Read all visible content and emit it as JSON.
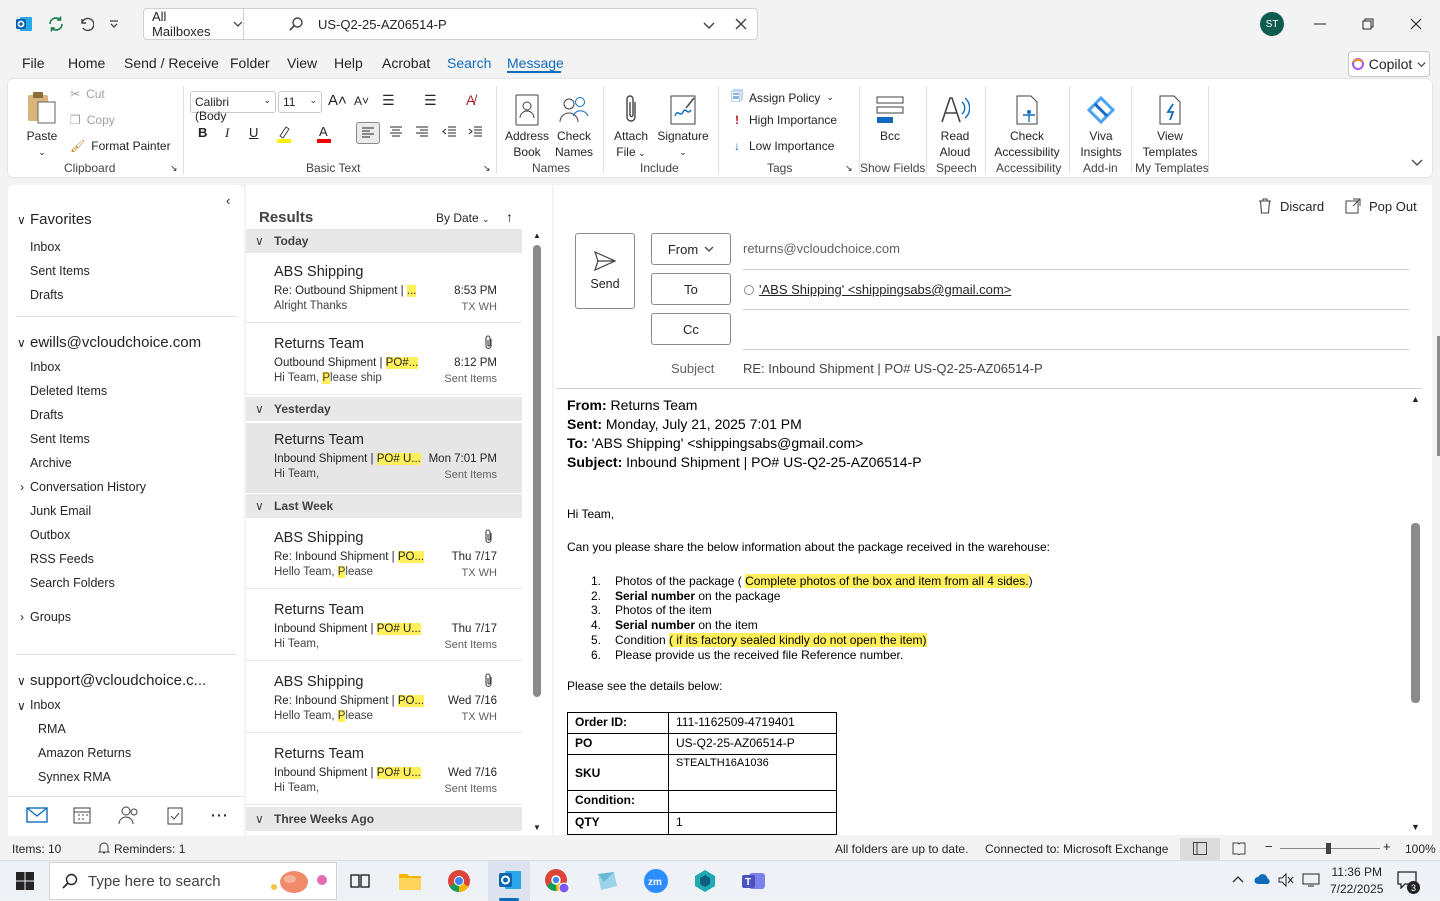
{
  "titlebar": {
    "mailbox_scope": "All Mailboxes",
    "search_value": "US-Q2-25-AZ06514-P",
    "avatar_initials": "ST"
  },
  "menu": {
    "items": [
      "File",
      "Home",
      "Send / Receive",
      "Folder",
      "View",
      "Help",
      "Acrobat",
      "Search",
      "Message"
    ],
    "active": "Message",
    "copilot": "Copilot"
  },
  "ribbon": {
    "paste": "Paste",
    "cut": "Cut",
    "copy": "Copy",
    "format_painter": "Format Painter",
    "font_name": "Calibri (Body",
    "font_size": "11",
    "address_book": [
      "Address",
      "Book"
    ],
    "check_names": [
      "Check",
      "Names"
    ],
    "attach_file": [
      "Attach",
      "File"
    ],
    "signature": "Signature",
    "assign_policy": "Assign Policy",
    "high_importance": "High Importance",
    "low_importance": "Low Importance",
    "bcc": "Bcc",
    "read_aloud": [
      "Read",
      "Aloud"
    ],
    "check_accessibility": [
      "Check",
      "Accessibility"
    ],
    "viva_insights": [
      "Viva",
      "Insights"
    ],
    "view_templates": [
      "View",
      "Templates"
    ],
    "groups": {
      "clipboard": "Clipboard",
      "basic_text": "Basic Text",
      "names": "Names",
      "include": "Include",
      "tags": "Tags",
      "show_fields": "Show Fields",
      "speech": "Speech",
      "accessibility": "Accessibility",
      "addin": "Add-in",
      "my_templates": "My Templates"
    }
  },
  "nav": {
    "favorites": "Favorites",
    "fav_items": [
      "Inbox",
      "Sent Items",
      "Drafts"
    ],
    "account1": "ewills@vcloudchoice.com",
    "acc1_items": [
      "Inbox",
      "Deleted Items",
      "Drafts",
      "Sent Items",
      "Archive",
      "Conversation History",
      "Junk Email",
      "Outbox",
      "RSS Feeds",
      "Search Folders"
    ],
    "groups": "Groups",
    "account2": "support@vcloudchoice.c...",
    "acc2_inbox": "Inbox",
    "acc2_sub": [
      "RMA",
      "Amazon Returns",
      "Synnex RMA"
    ]
  },
  "list": {
    "title": "Results",
    "sort": "By Date",
    "groups": [
      "Today",
      "Yesterday",
      "Last Week",
      "Three Weeks Ago"
    ],
    "mails": [
      {
        "from": "ABS Shipping",
        "subj": "Re: Outbound Shipment | ",
        "prev_a": "Alright  Thanks",
        "prev_hl": "",
        "time": "8:53 PM",
        "folder": "TX WH",
        "hl": "..."
      },
      {
        "from": "Returns Team",
        "subj": "Outbound Shipment | ",
        "prev_a": "Hi Team,  ",
        "prev_hl": "P",
        "prev_b": "lease ship",
        "time": "8:12 PM",
        "folder": "Sent Items",
        "hl": "PO#..."
      },
      {
        "from": "Returns Team",
        "subj": "Inbound Shipment | ",
        "prev_a": "Hi Team,",
        "prev_hl": "",
        "time": "Mon 7:01 PM",
        "folder": "Sent Items",
        "hl": "PO# U..."
      },
      {
        "from": "ABS Shipping",
        "subj": "Re: Inbound Shipment | ",
        "prev_a": "Hello Team,  ",
        "prev_hl": "P",
        "prev_b": "lease",
        "time": "Thu 7/17",
        "folder": "TX WH",
        "hl": "PO..."
      },
      {
        "from": "Returns Team",
        "subj": "Inbound Shipment | ",
        "prev_a": "Hi Team,",
        "prev_hl": "",
        "time": "Thu 7/17",
        "folder": "Sent Items",
        "hl": "PO# U..."
      },
      {
        "from": "ABS Shipping",
        "subj": "Re: Inbound Shipment | ",
        "prev_a": "Hello Team,  ",
        "prev_hl": "P",
        "prev_b": "lease",
        "time": "Wed 7/16",
        "folder": "TX WH",
        "hl": "PO..."
      },
      {
        "from": "Returns Team",
        "subj": "Inbound Shipment | ",
        "prev_a": "Hi Team,",
        "prev_hl": "",
        "time": "Wed 7/16",
        "folder": "Sent Items",
        "hl": "PO# U..."
      }
    ]
  },
  "compose": {
    "discard": "Discard",
    "pop_out": "Pop Out",
    "send": "Send",
    "from_btn": "From",
    "from_value": "returns@vcloudchoice.com",
    "to_btn": "To",
    "to_value": "'ABS Shipping' <shippingsabs@gmail.com>",
    "cc_btn": "Cc",
    "subject_label": "Subject",
    "subject_value": "RE: Inbound Shipment | PO# US-Q2-25-AZ06514-P"
  },
  "body": {
    "from_lbl": "From:",
    "from_val": " Returns Team",
    "sent_lbl": "Sent:",
    "sent_val": " Monday, July 21, 2025 7:01 PM",
    "to_lbl": "To:",
    "to_val": " 'ABS Shipping' <shippingsabs@gmail.com>",
    "subj_lbl": "Subject:",
    "subj_val": " Inbound Shipment | PO# US-Q2-25-AZ06514-P",
    "greeting": "Hi Team,",
    "intro": "Can you please share the below information about the package received in the warehouse:",
    "li1_a": "Photos of the package ( ",
    "li1_hl": "Complete photos of the box and item from all 4 sides.",
    "li1_b": ")",
    "li2_b": "Serial number",
    "li2_a": " on the package",
    "li3": "Photos of the item",
    "li4_b": "Serial number",
    "li4_a": " on the item",
    "li5_a": "Condition ",
    "li5_hl": "( if its factory sealed kindly do not open the item)",
    "li6": "Please provide us the received file Reference number.",
    "details": "Please see the details below:",
    "table": [
      [
        "Order ID:",
        "111-1162509-4719401"
      ],
      [
        "PO",
        "US-Q2-25-AZ06514-P"
      ],
      [
        "SKU",
        "STEALTH16A1036"
      ],
      [
        "Condition:",
        ""
      ],
      [
        "QTY",
        "1"
      ]
    ]
  },
  "status": {
    "items": "Items: 10",
    "reminders": "Reminders: 1",
    "sync": "All folders are up to date.",
    "conn": "Connected to: Microsoft Exchange",
    "zoom": "100%"
  },
  "taskbar": {
    "search_placeholder": "Type here to search",
    "time": "11:36 PM",
    "date": "7/22/2025",
    "notif_count": "3"
  }
}
